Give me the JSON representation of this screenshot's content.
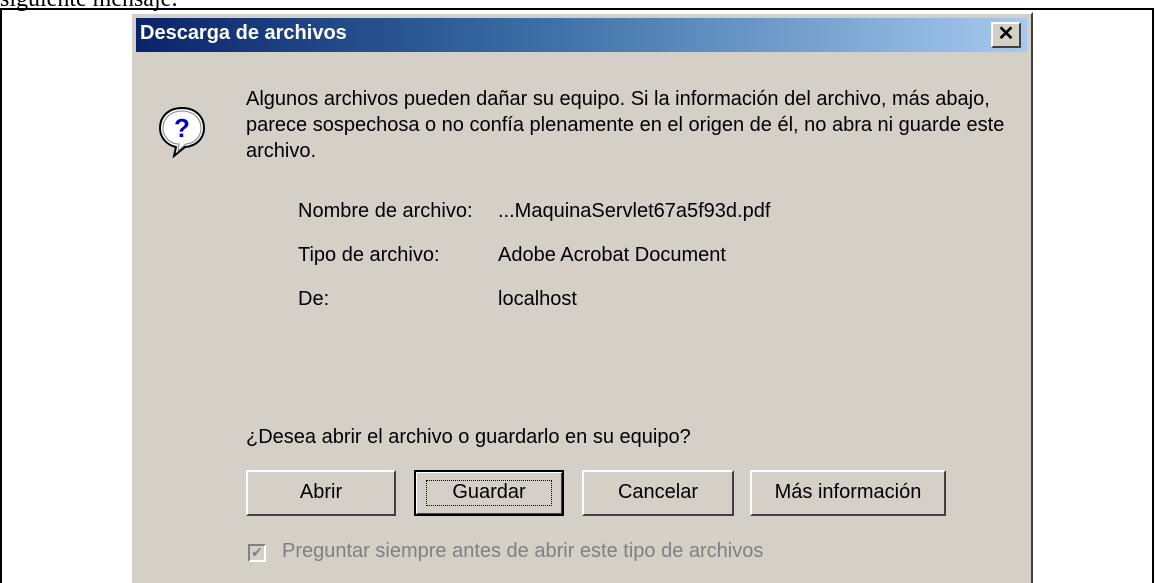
{
  "document": {
    "top_text": "siguiente mensaje:"
  },
  "dialog": {
    "title": "Descarga de archivos",
    "close_label": "×",
    "icon": "question-icon",
    "message": "Algunos archivos pueden dañar su equipo. Si la información del archivo, más abajo, parece sospechosa o no confía plenamente en el origen de él, no abra ni guarde este archivo.",
    "file_name_label": "Nombre de archivo:",
    "file_name_value": "...MaquinaServlet67a5f93d.pdf",
    "file_type_label": "Tipo de archivo:",
    "file_type_value": "Adobe Acrobat Document",
    "from_label": "De:",
    "from_value": "localhost",
    "question": "¿Desea abrir el archivo o guardarlo en su equipo?",
    "buttons": {
      "open": "Abrir",
      "save": "Guardar",
      "cancel": "Cancelar",
      "more_info": "Más información"
    },
    "checkbox": {
      "label": "Preguntar siempre antes de abrir este tipo de archivos",
      "checked": true,
      "disabled": true
    }
  },
  "colors": {
    "title_start": "#0a246a",
    "title_end": "#a6caf0",
    "dialog_bg": "#d4d0c8"
  }
}
